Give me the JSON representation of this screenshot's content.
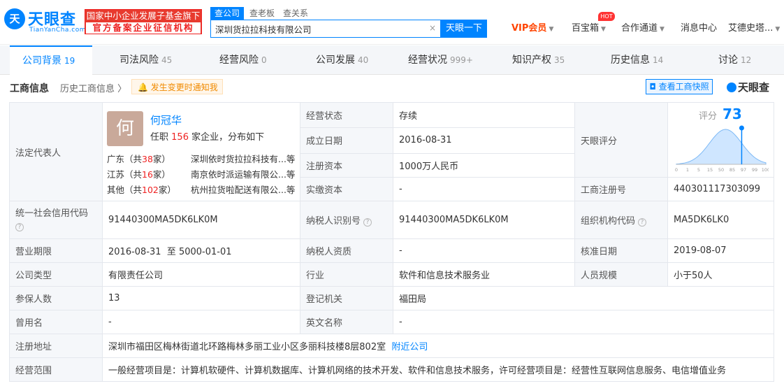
{
  "header": {
    "logo_mark": "天",
    "logo_name": "天眼查",
    "logo_domain": "TianYanCha.com",
    "badge_line1": "国家中小企业发展子基金旗下",
    "badge_line2": "官方备案企业征信机构",
    "search_tabs": [
      "查公司",
      "查老板",
      "查关系"
    ],
    "search_value": "深圳货拉拉科技有限公司",
    "search_clear": "×",
    "search_button": "天眼一下",
    "nav": {
      "vip": "VIP会员",
      "baibao": "百宝箱",
      "hot": "HOT",
      "channel": "合作通道",
      "messages": "消息中心",
      "user": "艾德史塔..."
    }
  },
  "tabs": [
    {
      "label": "公司背景",
      "count": "19"
    },
    {
      "label": "司法风险",
      "count": "45"
    },
    {
      "label": "经营风险",
      "count": "0"
    },
    {
      "label": "公司发展",
      "count": "40"
    },
    {
      "label": "经营状况",
      "count": "999+"
    },
    {
      "label": "知识产权",
      "count": "35"
    },
    {
      "label": "历史信息",
      "count": "14"
    },
    {
      "label": "讨论",
      "count": "12"
    }
  ],
  "subheader": {
    "title": "工商信息",
    "history": "历史工商信息",
    "notify": "发生变更时通知我",
    "view_license": "查看工商快照",
    "brand": "天眼查"
  },
  "legal_rep": {
    "label": "法定代表人",
    "avatar_char": "何",
    "name": "何冠华",
    "desc_prefix": "任职",
    "desc_count": "156",
    "desc_suffix": "家企业，分布如下",
    "provinces": [
      {
        "prov": "广东（共",
        "count": "38",
        "unit": "家）",
        "company": "深圳依时货拉拉科技有...等"
      },
      {
        "prov": "江苏（共",
        "count": "16",
        "unit": "家）",
        "company": "南京依时派运输有限公...等"
      },
      {
        "prov": "其他（共",
        "count": "102",
        "unit": "家）",
        "company": "杭州拉货啦配送有限公...等"
      }
    ]
  },
  "fields": {
    "status_label": "经营状态",
    "status": "存续",
    "founded_label": "成立日期",
    "founded": "2016-08-31",
    "reg_capital_label": "注册资本",
    "reg_capital": "1000万人民币",
    "paid_capital_label": "实缴资本",
    "paid_capital": "-",
    "score_label": "天眼评分",
    "score_text": "评分",
    "score_value": "73",
    "score_ticks": [
      "0",
      "1",
      "5",
      "15",
      "50",
      "85",
      "97",
      "99",
      "100"
    ],
    "reg_no_label": "工商注册号",
    "reg_no": "440301117303099",
    "credit_code_label": "统一社会信用代码",
    "credit_code": "91440300MA5DK6LK0M",
    "tax_id_label": "纳税人识别号",
    "tax_id": "91440300MA5DK6LK0M",
    "org_code_label": "组织机构代码",
    "org_code": "MA5DK6LK0",
    "term_label": "营业期限",
    "term": "2016-08-31  至 5000-01-01",
    "taxpayer_label": "纳税人资质",
    "taxpayer": "-",
    "approve_label": "核准日期",
    "approve": "2019-08-07",
    "type_label": "公司类型",
    "type": "有限责任公司",
    "industry_label": "行业",
    "industry": "软件和信息技术服务业",
    "staff_label": "人员规模",
    "staff": "小于50人",
    "insured_label": "参保人数",
    "insured": "13",
    "authority_label": "登记机关",
    "authority": "福田局",
    "former_label": "曾用名",
    "former": "-",
    "english_label": "英文名称",
    "english": "-",
    "address_label": "注册地址",
    "address": "深圳市福田区梅林街道北环路梅林多丽工业小区多丽科技楼8层802室",
    "nearby": "附近公司",
    "scope_label": "经营范围",
    "scope": "一般经营项目是：计算机软硬件、计算机数据库、计算机网络的技术开发、软件和信息技术服务，许可经营项目是：经营性互联网信息服务、电信增值业务"
  },
  "colors": {
    "accent": "#0084ff",
    "alert": "#e83a2e",
    "vip": "#ff4400"
  }
}
